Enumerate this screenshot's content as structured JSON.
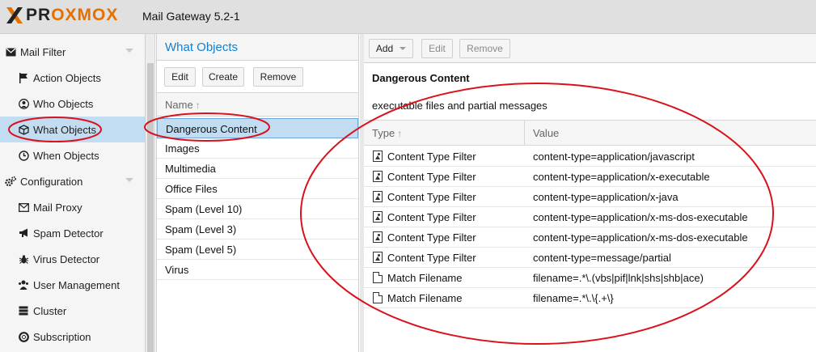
{
  "header": {
    "logo_part1": "PR",
    "logo_part2": "OXMOX",
    "version": "Mail Gateway 5.2-1"
  },
  "nav": {
    "groups": [
      {
        "label": "Mail Filter",
        "icon": "envelope-icon"
      },
      {
        "label": "Configuration",
        "icon": "gears-icon"
      }
    ],
    "items": [
      {
        "label": "Action Objects",
        "icon": "flag-icon"
      },
      {
        "label": "Who Objects",
        "icon": "user-icon"
      },
      {
        "label": "What Objects",
        "icon": "cube-icon",
        "selected": true
      },
      {
        "label": "When Objects",
        "icon": "clock-icon"
      },
      {
        "label": "Mail Proxy",
        "icon": "envelope-icon"
      },
      {
        "label": "Spam Detector",
        "icon": "bullhorn-icon"
      },
      {
        "label": "Virus Detector",
        "icon": "bug-icon"
      },
      {
        "label": "User Management",
        "icon": "users-icon"
      },
      {
        "label": "Cluster",
        "icon": "server-icon"
      },
      {
        "label": "Subscription",
        "icon": "support-icon"
      }
    ]
  },
  "middle": {
    "title": "What Objects",
    "toolbar": {
      "edit": "Edit",
      "create": "Create",
      "remove": "Remove"
    },
    "column": "Name",
    "rows": [
      "Dangerous Content",
      "Images",
      "Multimedia",
      "Office Files",
      "Spam (Level 10)",
      "Spam (Level 3)",
      "Spam (Level 5)",
      "Virus"
    ],
    "selected_index": 0
  },
  "right": {
    "toolbar": {
      "add": "Add",
      "edit": "Edit",
      "remove": "Remove"
    },
    "title": "Dangerous Content",
    "description": "executable files and partial messages",
    "columns": {
      "type": "Type",
      "value": "Value"
    },
    "rows": [
      {
        "icon": "image-file-icon",
        "type": "Content Type Filter",
        "value": "content-type=application/javascript"
      },
      {
        "icon": "image-file-icon",
        "type": "Content Type Filter",
        "value": "content-type=application/x-executable"
      },
      {
        "icon": "image-file-icon",
        "type": "Content Type Filter",
        "value": "content-type=application/x-java"
      },
      {
        "icon": "image-file-icon",
        "type": "Content Type Filter",
        "value": "content-type=application/x-ms-dos-executable"
      },
      {
        "icon": "image-file-icon",
        "type": "Content Type Filter",
        "value": "content-type=application/x-ms-dos-executable"
      },
      {
        "icon": "image-file-icon",
        "type": "Content Type Filter",
        "value": "content-type=message/partial"
      },
      {
        "icon": "file-icon",
        "type": "Match Filename",
        "value": "filename=.*\\.(vbs|pif|lnk|shs|shb|ace)"
      },
      {
        "icon": "file-icon",
        "type": "Match Filename",
        "value": "filename=.*\\.\\{.+\\}"
      }
    ]
  },
  "colors": {
    "accent": "#157fcc",
    "brand_orange": "#e57000",
    "selection": "#c2ddf2",
    "annotation": "#d9121b"
  }
}
